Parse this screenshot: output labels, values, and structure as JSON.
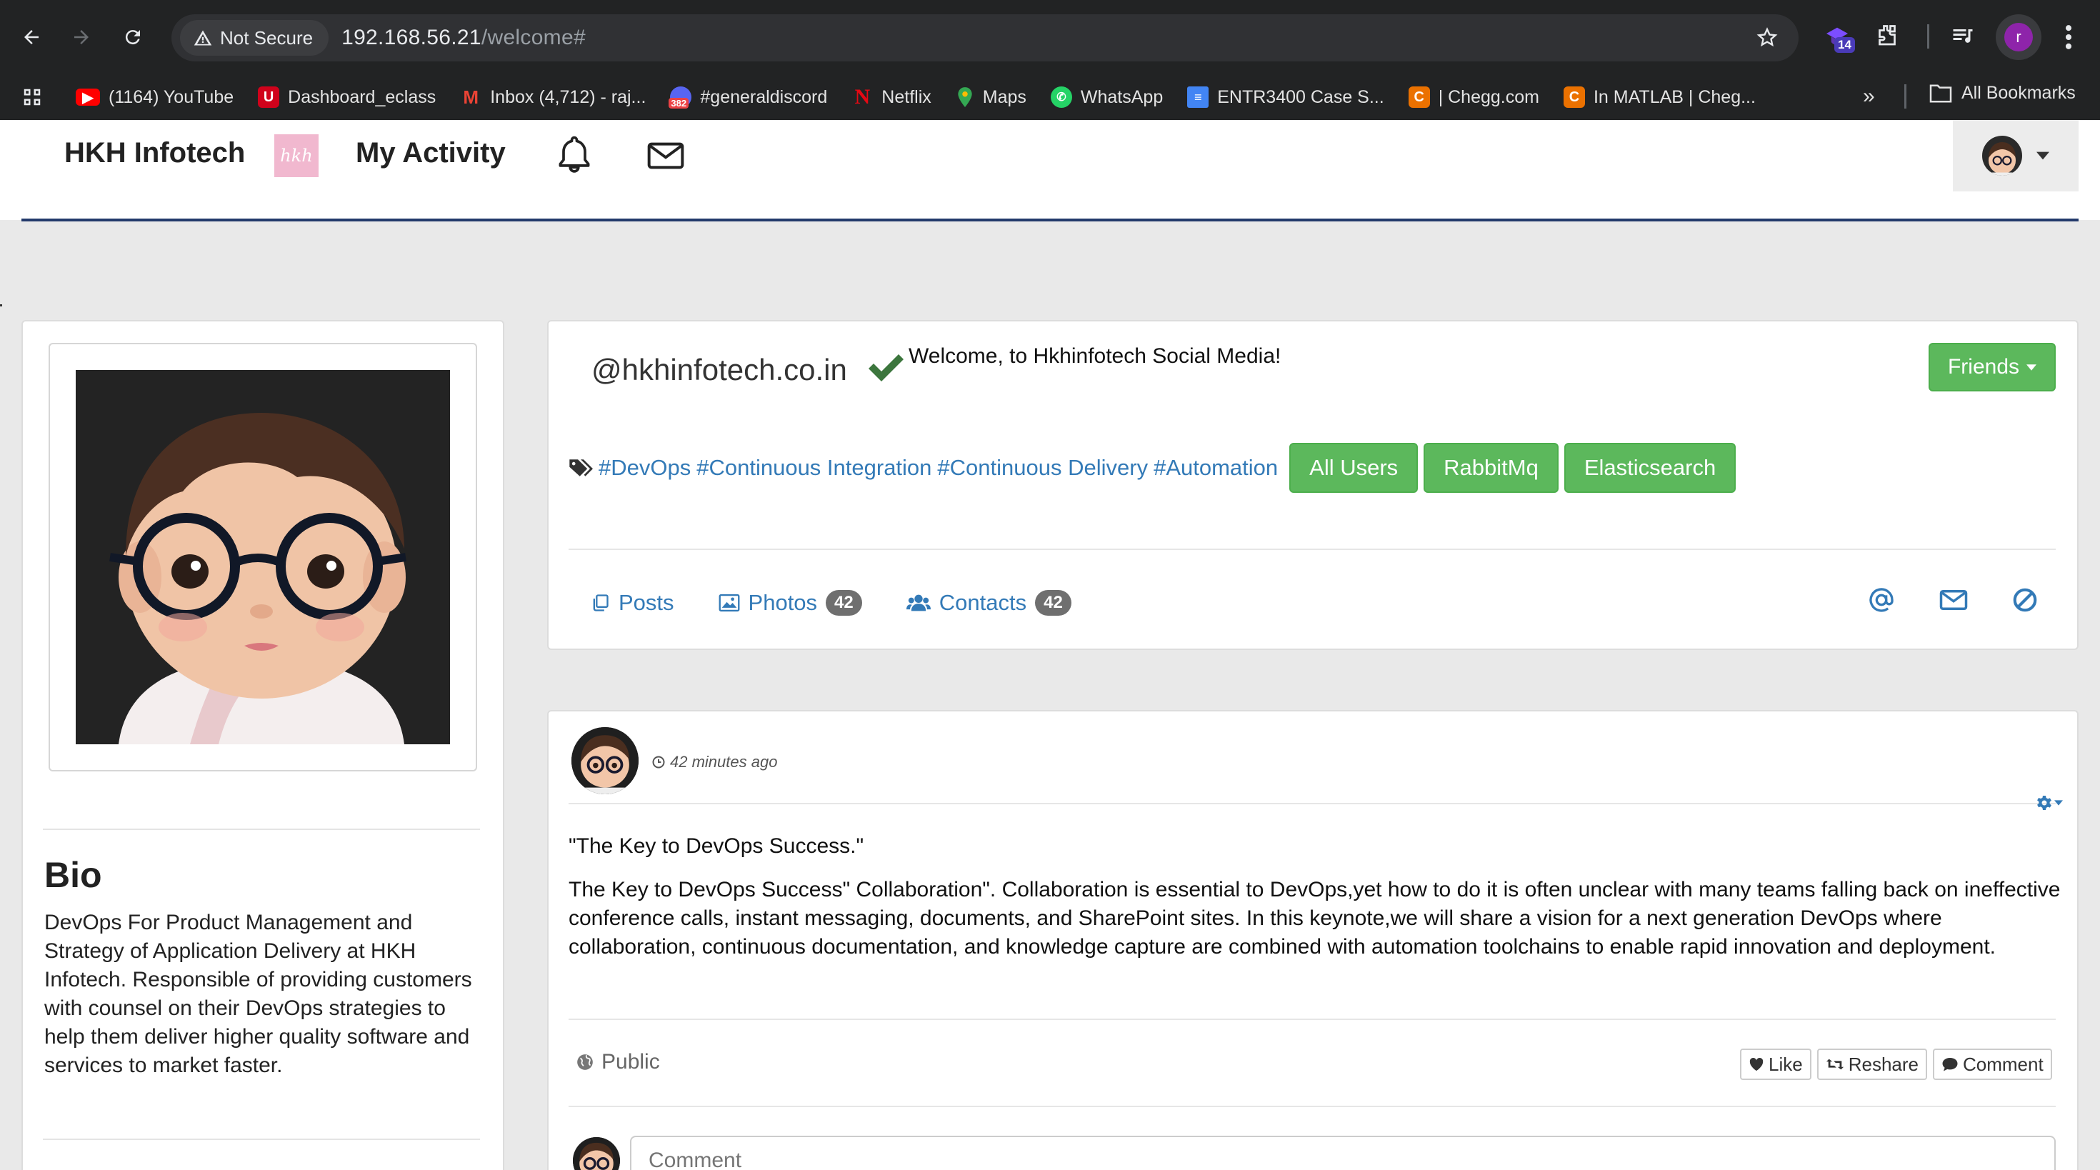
{
  "browser": {
    "security_label": "Not Secure",
    "url_host": "192.168.56.21",
    "url_path": "/welcome#",
    "extension_badge": "14",
    "profile_initial": "r",
    "bookmarks": [
      {
        "label": "(1164) YouTube",
        "icon": "youtube-icon",
        "color": "#ff0000"
      },
      {
        "label": "Dashboard_eclass",
        "icon": "eclass-icon",
        "color": "#d0021b"
      },
      {
        "label": "Inbox (4,712) - raj...",
        "icon": "gmail-icon",
        "color": "#ea4335"
      },
      {
        "label": "#generaldiscord",
        "icon": "discord-icon",
        "color": "#5865f2",
        "badge": "382"
      },
      {
        "label": "Netflix",
        "icon": "netflix-icon",
        "color": "#e50914"
      },
      {
        "label": "Maps",
        "icon": "maps-icon",
        "color": "#34a853"
      },
      {
        "label": "WhatsApp",
        "icon": "whatsapp-icon",
        "color": "#25d366"
      },
      {
        "label": "ENTR3400 Case S...",
        "icon": "docs-icon",
        "color": "#4285f4"
      },
      {
        "label": "| Chegg.com",
        "icon": "chegg-icon",
        "color": "#eb7100"
      },
      {
        "label": "In MATLAB | Cheg...",
        "icon": "chegg-icon",
        "color": "#eb7100"
      }
    ],
    "all_bookmarks_label": "All Bookmarks"
  },
  "site": {
    "brand": "HKH Infotech",
    "logo_text": "hkh",
    "my_activity": "My Activity"
  },
  "profile": {
    "handle": "@hkhinfotech.co.in",
    "welcome": "Welcome, to Hkhinfotech Social Media!",
    "friends_label": "Friends",
    "hashtags": [
      "#DevOps",
      "#Continuous Integration",
      "#Continuous Delivery",
      "#Automation"
    ],
    "tag_buttons": [
      "All Users",
      "RabbitMq",
      "Elasticsearch"
    ],
    "tabs": {
      "posts": "Posts",
      "photos": "Photos",
      "photos_count": "42",
      "contacts": "Contacts",
      "contacts_count": "42"
    },
    "bio_title": "Bio",
    "bio_text": "DevOps For Product Management and Strategy of Application Delivery at HKH Infotech. Responsible of providing customers with counsel on their DevOps strategies to help them deliver higher quality software and services to market faster."
  },
  "post": {
    "time": "42 minutes ago",
    "title": "\"The Key to DevOps Success.\"",
    "body": "The Key to DevOps Success\" Collaboration\". Collaboration is essential to DevOps,yet how to do it is often unclear with many teams falling back on ineffective conference calls, instant messaging, documents, and SharePoint sites. In this keynote,we will share a vision for a next generation DevOps where collaboration, continuous documentation, and knowledge capture are combined with automation toolchains to enable rapid innovation and deployment.",
    "visibility": "Public",
    "like": "Like",
    "reshare": "Reshare",
    "comment": "Comment",
    "comment_placeholder": "Comment"
  },
  "colors": {
    "accent_green": "#5cb85c",
    "link_blue": "#337ab7",
    "verified_green": "#3c763d",
    "header_rule": "#233a6b"
  }
}
